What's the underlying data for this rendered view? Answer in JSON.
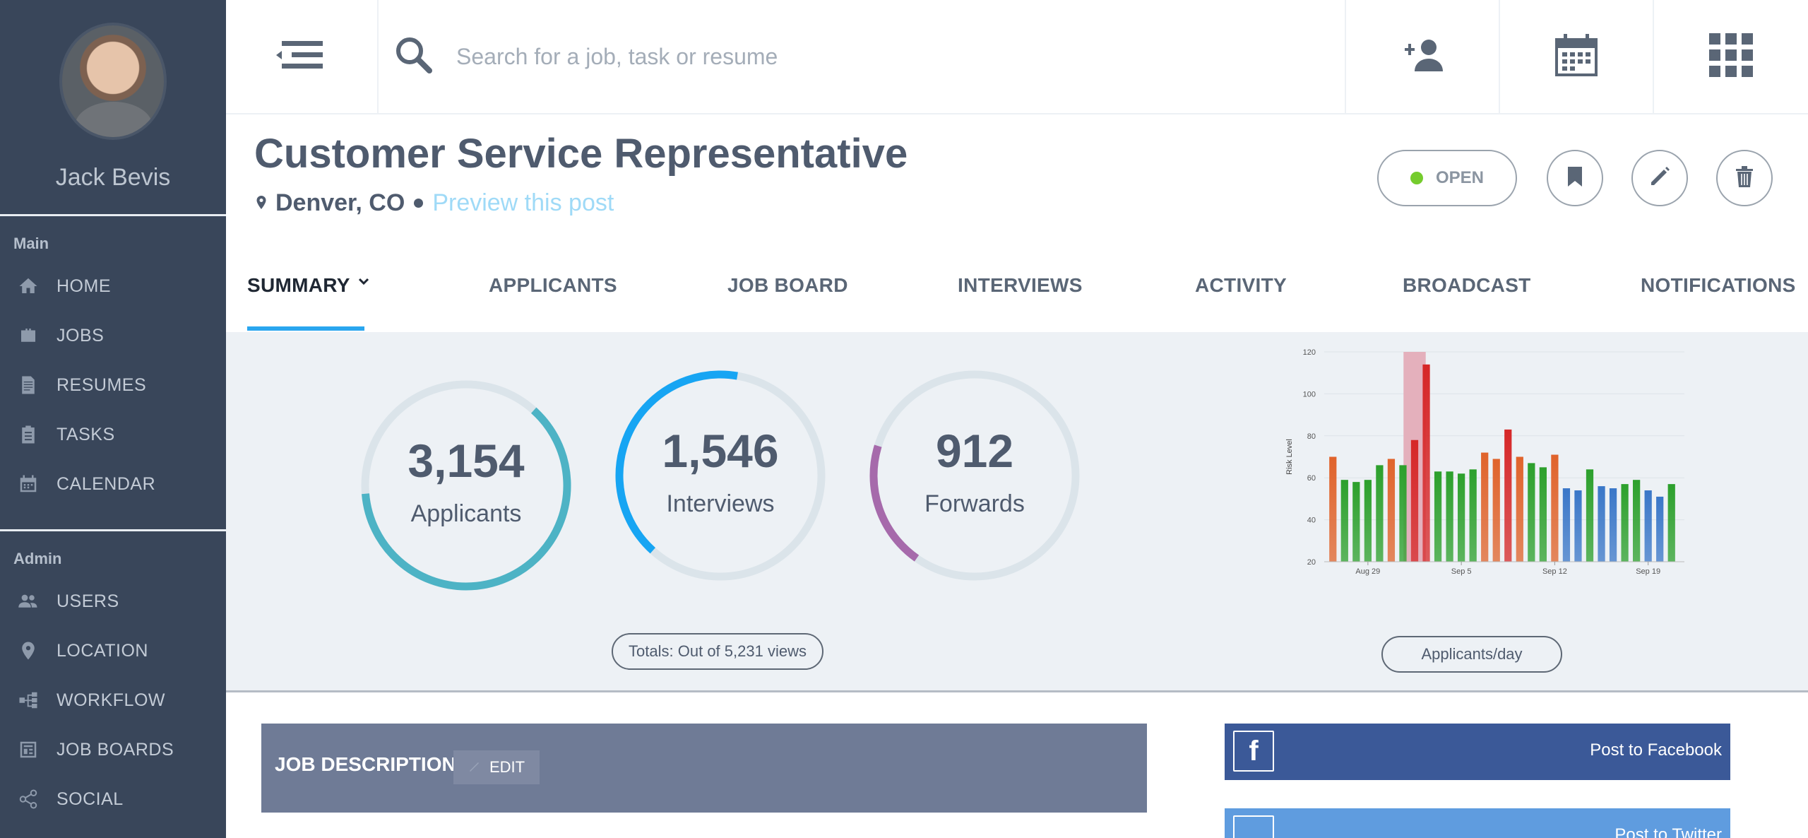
{
  "user": {
    "name": "Jack Bevis"
  },
  "sidebar": {
    "main_label": "Main",
    "main_items": [
      {
        "label": "HOME",
        "icon": "home-icon"
      },
      {
        "label": "JOBS",
        "icon": "briefcase-icon"
      },
      {
        "label": "RESUMES",
        "icon": "document-icon"
      },
      {
        "label": "TASKS",
        "icon": "clipboard-icon"
      },
      {
        "label": "CALENDAR",
        "icon": "calendar-icon"
      }
    ],
    "admin_label": "Admin",
    "admin_items": [
      {
        "label": "USERS",
        "icon": "users-icon"
      },
      {
        "label": "LOCATION",
        "icon": "map-pin-icon"
      },
      {
        "label": "WORKFLOW",
        "icon": "workflow-icon"
      },
      {
        "label": "JOB BOARDS",
        "icon": "job-boards-icon"
      },
      {
        "label": "SOCIAL",
        "icon": "share-icon"
      }
    ]
  },
  "topbar": {
    "search_placeholder": "Search for a job, task or resume",
    "icons": [
      "menu-icon",
      "search-icon",
      "add-user-icon",
      "calendar-icon",
      "apps-grid-icon"
    ]
  },
  "job": {
    "title": "Customer Service Representative",
    "location": "Denver, CO",
    "preview_link": "Preview this post",
    "status": "OPEN",
    "status_color": "#75cc2d"
  },
  "tabs": [
    {
      "label": "SUMMARY",
      "active": true
    },
    {
      "label": "APPLICANTS"
    },
    {
      "label": "JOB BOARD"
    },
    {
      "label": "INTERVIEWS"
    },
    {
      "label": "ACTIVITY"
    },
    {
      "label": "BROADCAST"
    },
    {
      "label": "NOTIFICATIONS"
    }
  ],
  "stats": [
    {
      "value": "3,154",
      "label": "Applicants",
      "color": "#4db3c5",
      "fraction": 0.62
    },
    {
      "value": "1,546",
      "label": "Interviews",
      "color": "#17a5f3",
      "fraction": 0.41
    },
    {
      "value": "912",
      "label": "Forwards",
      "color": "#a66aab",
      "fraction": 0.2
    }
  ],
  "totals_label": "Totals: Out of 5,231 views",
  "chart_button": "Applicants/day",
  "chart_data": {
    "type": "bar",
    "ylabel": "Risk Level",
    "ylim": [
      20,
      120
    ],
    "yticks": [
      20,
      40,
      60,
      80,
      100,
      120
    ],
    "xticks": [
      "Aug 29",
      "Sep 5",
      "Sep 12",
      "Sep 19"
    ],
    "highlight_color": "#e4b0bc",
    "series": [
      {
        "values": [
          70,
          59,
          58,
          59,
          66,
          69,
          66,
          78,
          114,
          63,
          63,
          62,
          64,
          72,
          69,
          83,
          70,
          67,
          65,
          71,
          55,
          54,
          64,
          56,
          55,
          57,
          59,
          54,
          51,
          57
        ],
        "colors": [
          "#e0632b",
          "#2ca02c",
          "#2ca02c",
          "#2ca02c",
          "#2ca02c",
          "#e0632b",
          "#2ca02c",
          "#d62728",
          "#d62728",
          "#2ca02c",
          "#2ca02c",
          "#2ca02c",
          "#2ca02c",
          "#e0632b",
          "#e0632b",
          "#d62728",
          "#e0632b",
          "#2ca02c",
          "#2ca02c",
          "#e0632b",
          "#3a77c8",
          "#3a77c8",
          "#2ca02c",
          "#3a77c8",
          "#3a77c8",
          "#2ca02c",
          "#2ca02c",
          "#3a77c8",
          "#3a77c8",
          "#2ca02c"
        ]
      }
    ]
  },
  "job_description": {
    "title": "JOB DESCRIPTION",
    "edit_label": "EDIT"
  },
  "social": {
    "facebook_label": "Post to Facebook",
    "twitter_label": "Post to Twitter"
  }
}
